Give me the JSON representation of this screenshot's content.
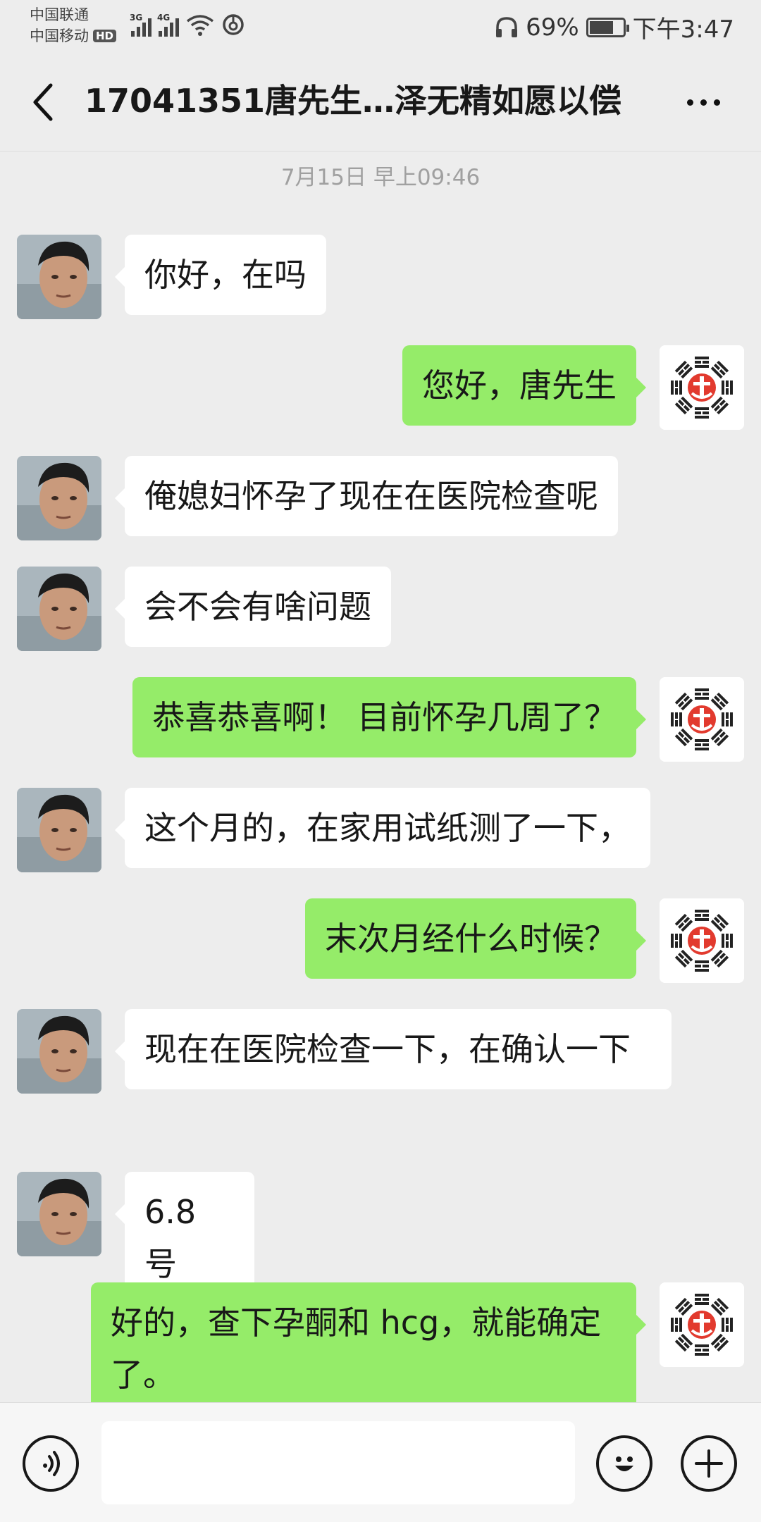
{
  "status_bar": {
    "carrier1": "中国联通",
    "carrier2": "中国移动",
    "hd": "HD",
    "net1": "3G",
    "net2": "4G",
    "battery_percent": "69%",
    "battery_level": 0.69,
    "time": "下午3:47"
  },
  "header": {
    "title": "17041351唐先生…泽无精如愿以偿"
  },
  "chat": {
    "timestamp": "7月15日 早上09:46",
    "messages": [
      {
        "side": "left",
        "text": "你好，在吗"
      },
      {
        "side": "right",
        "text": "您好，唐先生"
      },
      {
        "side": "left",
        "text": "俺媳妇怀孕了现在在医院检查呢"
      },
      {
        "side": "left",
        "text": "会不会有啥问题"
      },
      {
        "side": "right",
        "text": "恭喜恭喜啊！ 目前怀孕几周了？"
      },
      {
        "side": "left",
        "text": "这个月的，在家用试纸测了一下，"
      },
      {
        "side": "right",
        "text": "末次月经什么时候？"
      },
      {
        "side": "left",
        "text": "现在在医院检查一下，在确认一下"
      },
      {
        "side": "left",
        "text": "6.8 号"
      },
      {
        "side": "right",
        "text": "好的，查下孕酮和 hcg，就能确定了。"
      }
    ]
  },
  "input": {
    "placeholder": ""
  },
  "icons": {
    "back": "back-arrow-icon",
    "more": "more-dots-icon",
    "voice": "voice-icon",
    "emoji": "emoji-icon",
    "plus": "plus-icon"
  },
  "colors": {
    "background": "#ededed",
    "bubble_self": "#95ec69",
    "bubble_other": "#ffffff",
    "logo_red": "#e23a2e"
  }
}
